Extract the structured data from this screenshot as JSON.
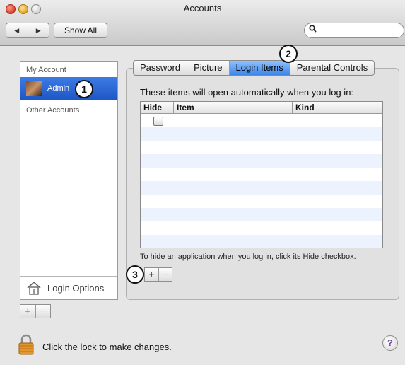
{
  "window": {
    "title": "Accounts"
  },
  "toolbar": {
    "back_glyph": "◀",
    "forward_glyph": "▶",
    "show_all": "Show All",
    "search_placeholder": ""
  },
  "sidebar": {
    "my_account_header": "My Account",
    "admin_label": "Admin",
    "other_accounts_header": "Other Accounts",
    "login_options_label": "Login Options",
    "add_glyph": "+",
    "remove_glyph": "−"
  },
  "tabs": [
    {
      "label": "Password"
    },
    {
      "label": "Picture"
    },
    {
      "label": "Login Items",
      "active": true
    },
    {
      "label": "Parental Controls"
    }
  ],
  "login_items": {
    "intro": "These items will open automatically when you log in:",
    "columns": {
      "hide": "Hide",
      "item": "Item",
      "kind": "Kind"
    },
    "hint": "To hide an application when you log in, click its Hide checkbox.",
    "add_glyph": "+",
    "remove_glyph": "−"
  },
  "callouts": {
    "one": "1",
    "two": "2",
    "three": "3"
  },
  "footer": {
    "lock_text": "Click the lock to make changes.",
    "help_glyph": "?"
  },
  "colors": {
    "selection": "#2f6fdc",
    "tab_active": "#5a9cf0",
    "row_stripe": "#edf3fe"
  },
  "icons": [
    "search-icon",
    "house-icon",
    "lock-icon",
    "help-icon"
  ]
}
